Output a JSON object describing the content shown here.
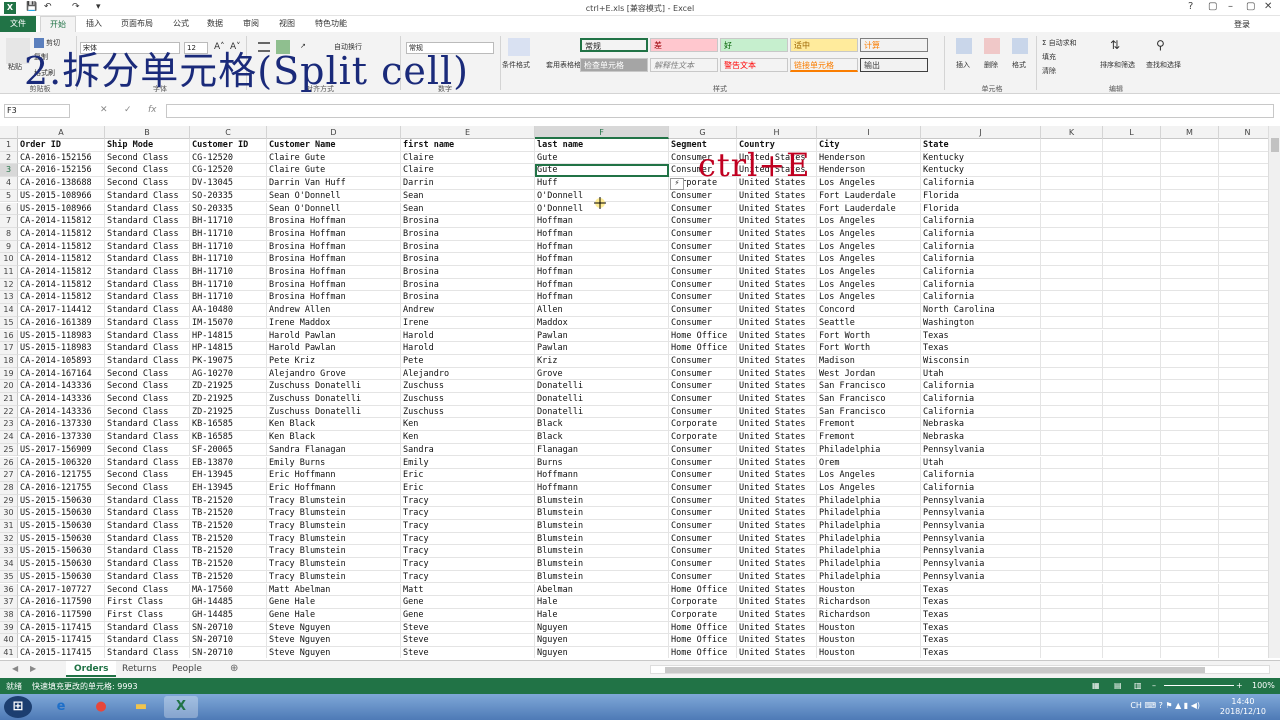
{
  "window": {
    "title": "ctrl+E.xls  [兼容模式] - Excel",
    "controls": [
      "?",
      "▢",
      "–",
      "▢",
      "✕"
    ]
  },
  "tabs": [
    "文件",
    "开始",
    "插入",
    "页面布局",
    "公式",
    "数据",
    "审阅",
    "视图",
    "特色功能"
  ],
  "login_label": "登录",
  "ribbon": {
    "clipboard": {
      "cut": "剪切",
      "copy": "复制",
      "format_painter": "格式刷",
      "paste": "粘贴",
      "group": "剪贴板"
    },
    "font": {
      "name": "宋体",
      "size": "12",
      "group": "字体"
    },
    "alignment": {
      "wrap": "自动换行",
      "group": "对齐方式"
    },
    "number": {
      "format": "常规",
      "group": "数字"
    },
    "styles": {
      "conditional": "条件格式",
      "table": "套用表格格式",
      "cells": [
        {
          "label": "常规",
          "bg": "#ffffff",
          "fg": "#000000"
        },
        {
          "label": "差",
          "bg": "#ffc7ce",
          "fg": "#9c0006"
        },
        {
          "label": "好",
          "bg": "#c6efce",
          "fg": "#006100"
        },
        {
          "label": "适中",
          "bg": "#ffeb9c",
          "fg": "#9c6500"
        },
        {
          "label": "计算",
          "bg": "#f2f2f2",
          "fg": "#fa7d00"
        },
        {
          "label": "检查单元格",
          "bg": "#a5a5a5",
          "fg": "#ffffff"
        },
        {
          "label": "解释性文本",
          "bg": "#ffffff",
          "fg": "#7f7f7f"
        },
        {
          "label": "警告文本",
          "bg": "#ffffff",
          "fg": "#ff0000"
        },
        {
          "label": "链接单元格",
          "bg": "#ffffff",
          "fg": "#fa7d00"
        },
        {
          "label": "输出",
          "bg": "#f2f2f2",
          "fg": "#3f3f3f"
        }
      ],
      "group": "样式"
    },
    "cells": {
      "insert": "插入",
      "delete": "删除",
      "format": "格式",
      "group": "单元格"
    },
    "editing": {
      "autosum": "自动求和",
      "fill": "填充",
      "clear": "清除",
      "sort": "排序和筛选",
      "find": "查找和选择",
      "group": "编辑"
    }
  },
  "overlay_title": "2.拆分单元格(Split cell)",
  "annotation": "ctrl+E",
  "formula_bar": {
    "name_box": "F3",
    "fx": "fx"
  },
  "columns": [
    "A",
    "B",
    "C",
    "D",
    "E",
    "F",
    "G",
    "H",
    "I",
    "J",
    "K",
    "L",
    "M",
    "N"
  ],
  "selected_column": "F",
  "selected_row": "3",
  "rows": [
    [
      "Order ID",
      "Ship Mode",
      "Customer ID",
      "Customer Name",
      "first name",
      "last name",
      "Segment",
      "Country",
      "City",
      "State"
    ],
    [
      "CA-2016-152156",
      "Second Class",
      "CG-12520",
      "Claire Gute",
      "Claire",
      "Gute",
      "Consumer",
      "United States",
      "Henderson",
      "Kentucky"
    ],
    [
      "CA-2016-152156",
      "Second Class",
      "CG-12520",
      "Claire Gute",
      "Claire",
      "Gute",
      "Consumer",
      "United States",
      "Henderson",
      "Kentucky"
    ],
    [
      "CA-2016-138688",
      "Second Class",
      "DV-13045",
      "Darrin Van Huff",
      "Darrin",
      "Huff",
      "Corporate",
      "United States",
      "Los Angeles",
      "California"
    ],
    [
      "US-2015-108966",
      "Standard Class",
      "SO-20335",
      "Sean O'Donnell",
      "Sean",
      "O'Donnell",
      "Consumer",
      "United States",
      "Fort Lauderdale",
      "Florida"
    ],
    [
      "US-2015-108966",
      "Standard Class",
      "SO-20335",
      "Sean O'Donnell",
      "Sean",
      "O'Donnell",
      "Consumer",
      "United States",
      "Fort Lauderdale",
      "Florida"
    ],
    [
      "CA-2014-115812",
      "Standard Class",
      "BH-11710",
      "Brosina Hoffman",
      "Brosina",
      "Hoffman",
      "Consumer",
      "United States",
      "Los Angeles",
      "California"
    ],
    [
      "CA-2014-115812",
      "Standard Class",
      "BH-11710",
      "Brosina Hoffman",
      "Brosina",
      "Hoffman",
      "Consumer",
      "United States",
      "Los Angeles",
      "California"
    ],
    [
      "CA-2014-115812",
      "Standard Class",
      "BH-11710",
      "Brosina Hoffman",
      "Brosina",
      "Hoffman",
      "Consumer",
      "United States",
      "Los Angeles",
      "California"
    ],
    [
      "CA-2014-115812",
      "Standard Class",
      "BH-11710",
      "Brosina Hoffman",
      "Brosina",
      "Hoffman",
      "Consumer",
      "United States",
      "Los Angeles",
      "California"
    ],
    [
      "CA-2014-115812",
      "Standard Class",
      "BH-11710",
      "Brosina Hoffman",
      "Brosina",
      "Hoffman",
      "Consumer",
      "United States",
      "Los Angeles",
      "California"
    ],
    [
      "CA-2014-115812",
      "Standard Class",
      "BH-11710",
      "Brosina Hoffman",
      "Brosina",
      "Hoffman",
      "Consumer",
      "United States",
      "Los Angeles",
      "California"
    ],
    [
      "CA-2014-115812",
      "Standard Class",
      "BH-11710",
      "Brosina Hoffman",
      "Brosina",
      "Hoffman",
      "Consumer",
      "United States",
      "Los Angeles",
      "California"
    ],
    [
      "CA-2017-114412",
      "Standard Class",
      "AA-10480",
      "Andrew Allen",
      "Andrew",
      "Allen",
      "Consumer",
      "United States",
      "Concord",
      "North Carolina"
    ],
    [
      "CA-2016-161389",
      "Standard Class",
      "IM-15070",
      "Irene Maddox",
      "Irene",
      "Maddox",
      "Consumer",
      "United States",
      "Seattle",
      "Washington"
    ],
    [
      "US-2015-118983",
      "Standard Class",
      "HP-14815",
      "Harold Pawlan",
      "Harold",
      "Pawlan",
      "Home Office",
      "United States",
      "Fort Worth",
      "Texas"
    ],
    [
      "US-2015-118983",
      "Standard Class",
      "HP-14815",
      "Harold Pawlan",
      "Harold",
      "Pawlan",
      "Home Office",
      "United States",
      "Fort Worth",
      "Texas"
    ],
    [
      "CA-2014-105893",
      "Standard Class",
      "PK-19075",
      "Pete Kriz",
      "Pete",
      "Kriz",
      "Consumer",
      "United States",
      "Madison",
      "Wisconsin"
    ],
    [
      "CA-2014-167164",
      "Second Class",
      "AG-10270",
      "Alejandro Grove",
      "Alejandro",
      "Grove",
      "Consumer",
      "United States",
      "West Jordan",
      "Utah"
    ],
    [
      "CA-2014-143336",
      "Second Class",
      "ZD-21925",
      "Zuschuss Donatelli",
      "Zuschuss",
      "Donatelli",
      "Consumer",
      "United States",
      "San Francisco",
      "California"
    ],
    [
      "CA-2014-143336",
      "Second Class",
      "ZD-21925",
      "Zuschuss Donatelli",
      "Zuschuss",
      "Donatelli",
      "Consumer",
      "United States",
      "San Francisco",
      "California"
    ],
    [
      "CA-2014-143336",
      "Second Class",
      "ZD-21925",
      "Zuschuss Donatelli",
      "Zuschuss",
      "Donatelli",
      "Consumer",
      "United States",
      "San Francisco",
      "California"
    ],
    [
      "CA-2016-137330",
      "Standard Class",
      "KB-16585",
      "Ken Black",
      "Ken",
      "Black",
      "Corporate",
      "United States",
      "Fremont",
      "Nebraska"
    ],
    [
      "CA-2016-137330",
      "Standard Class",
      "KB-16585",
      "Ken Black",
      "Ken",
      "Black",
      "Corporate",
      "United States",
      "Fremont",
      "Nebraska"
    ],
    [
      "US-2017-156909",
      "Second Class",
      "SF-20065",
      "Sandra Flanagan",
      "Sandra",
      "Flanagan",
      "Consumer",
      "United States",
      "Philadelphia",
      "Pennsylvania"
    ],
    [
      "CA-2015-106320",
      "Standard Class",
      "EB-13870",
      "Emily Burns",
      "Emily",
      "Burns",
      "Consumer",
      "United States",
      "Orem",
      "Utah"
    ],
    [
      "CA-2016-121755",
      "Second Class",
      "EH-13945",
      "Eric Hoffmann",
      "Eric",
      "Hoffmann",
      "Consumer",
      "United States",
      "Los Angeles",
      "California"
    ],
    [
      "CA-2016-121755",
      "Second Class",
      "EH-13945",
      "Eric Hoffmann",
      "Eric",
      "Hoffmann",
      "Consumer",
      "United States",
      "Los Angeles",
      "California"
    ],
    [
      "US-2015-150630",
      "Standard Class",
      "TB-21520",
      "Tracy Blumstein",
      "Tracy",
      "Blumstein",
      "Consumer",
      "United States",
      "Philadelphia",
      "Pennsylvania"
    ],
    [
      "US-2015-150630",
      "Standard Class",
      "TB-21520",
      "Tracy Blumstein",
      "Tracy",
      "Blumstein",
      "Consumer",
      "United States",
      "Philadelphia",
      "Pennsylvania"
    ],
    [
      "US-2015-150630",
      "Standard Class",
      "TB-21520",
      "Tracy Blumstein",
      "Tracy",
      "Blumstein",
      "Consumer",
      "United States",
      "Philadelphia",
      "Pennsylvania"
    ],
    [
      "US-2015-150630",
      "Standard Class",
      "TB-21520",
      "Tracy Blumstein",
      "Tracy",
      "Blumstein",
      "Consumer",
      "United States",
      "Philadelphia",
      "Pennsylvania"
    ],
    [
      "US-2015-150630",
      "Standard Class",
      "TB-21520",
      "Tracy Blumstein",
      "Tracy",
      "Blumstein",
      "Consumer",
      "United States",
      "Philadelphia",
      "Pennsylvania"
    ],
    [
      "US-2015-150630",
      "Standard Class",
      "TB-21520",
      "Tracy Blumstein",
      "Tracy",
      "Blumstein",
      "Consumer",
      "United States",
      "Philadelphia",
      "Pennsylvania"
    ],
    [
      "US-2015-150630",
      "Standard Class",
      "TB-21520",
      "Tracy Blumstein",
      "Tracy",
      "Blumstein",
      "Consumer",
      "United States",
      "Philadelphia",
      "Pennsylvania"
    ],
    [
      "CA-2017-107727",
      "Second Class",
      "MA-17560",
      "Matt Abelman",
      "Matt",
      "Abelman",
      "Home Office",
      "United States",
      "Houston",
      "Texas"
    ],
    [
      "CA-2016-117590",
      "First Class",
      "GH-14485",
      "Gene Hale",
      "Gene",
      "Hale",
      "Corporate",
      "United States",
      "Richardson",
      "Texas"
    ],
    [
      "CA-2016-117590",
      "First Class",
      "GH-14485",
      "Gene Hale",
      "Gene",
      "Hale",
      "Corporate",
      "United States",
      "Richardson",
      "Texas"
    ],
    [
      "CA-2015-117415",
      "Standard Class",
      "SN-20710",
      "Steve Nguyen",
      "Steve",
      "Nguyen",
      "Home Office",
      "United States",
      "Houston",
      "Texas"
    ],
    [
      "CA-2015-117415",
      "Standard Class",
      "SN-20710",
      "Steve Nguyen",
      "Steve",
      "Nguyen",
      "Home Office",
      "United States",
      "Houston",
      "Texas"
    ],
    [
      "CA-2015-117415",
      "Standard Class",
      "SN-20710",
      "Steve Nguyen",
      "Steve",
      "Nguyen",
      "Home Office",
      "United States",
      "Houston",
      "Texas"
    ]
  ],
  "sheets": [
    "Orders",
    "Returns",
    "People"
  ],
  "active_sheet": "Orders",
  "status": {
    "ready": "就绪",
    "message": "快速填充更改的单元格: 9993",
    "zoom": "100%"
  },
  "taskbar": {
    "time": "14:40",
    "date": "2018/12/10",
    "lang": "CH"
  },
  "colors": {
    "excel_green": "#217346",
    "overlay_title": "#1a2a7a",
    "annotation": "#c00020"
  }
}
